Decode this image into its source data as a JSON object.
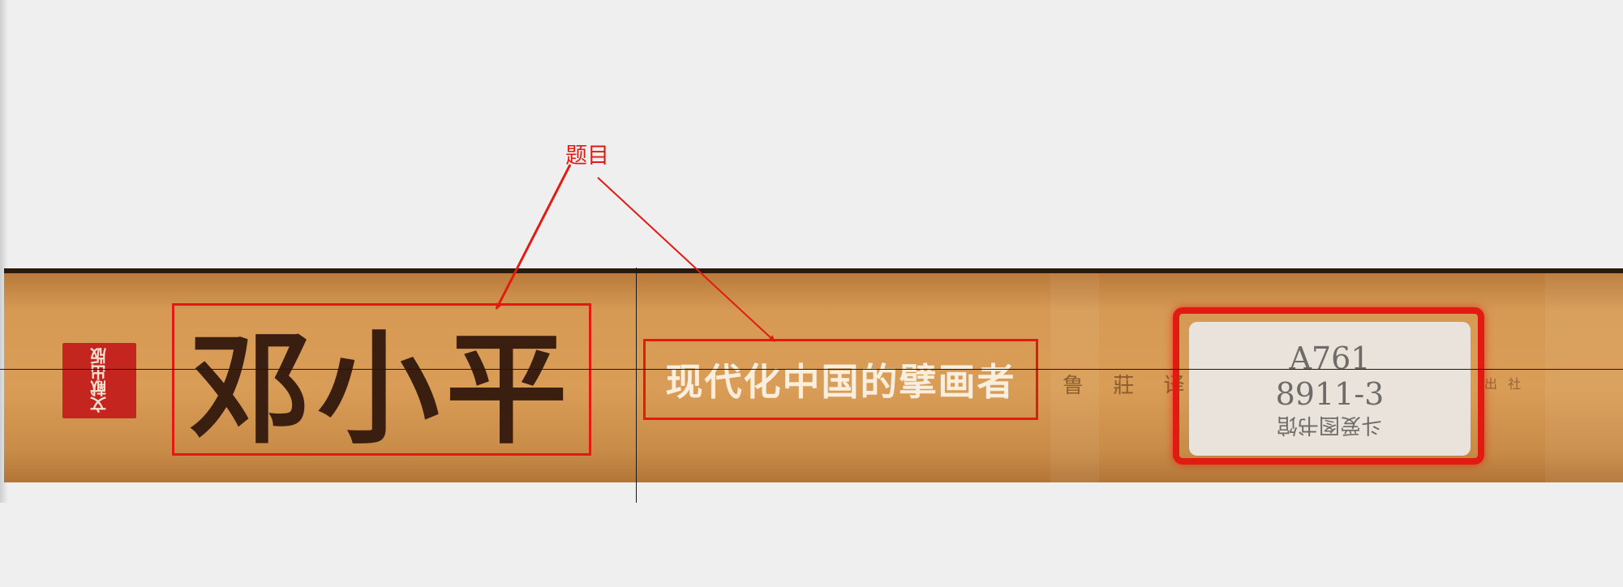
{
  "annotation": {
    "label": "题目"
  },
  "book_spine": {
    "publisher_logo_text": "文献出版",
    "title": "邓小平",
    "subtitle": "现代化中国的擘画者",
    "small_text": "鲁 莊 译",
    "tiny_text": "出 社",
    "library_label": {
      "line1": "A761",
      "line2": "8911-3",
      "line3": "斗爱图书馆"
    }
  },
  "colors": {
    "annotation_red": "#e21b12",
    "spine_tan": "#d69a55",
    "title_dark": "#3a1f10"
  }
}
